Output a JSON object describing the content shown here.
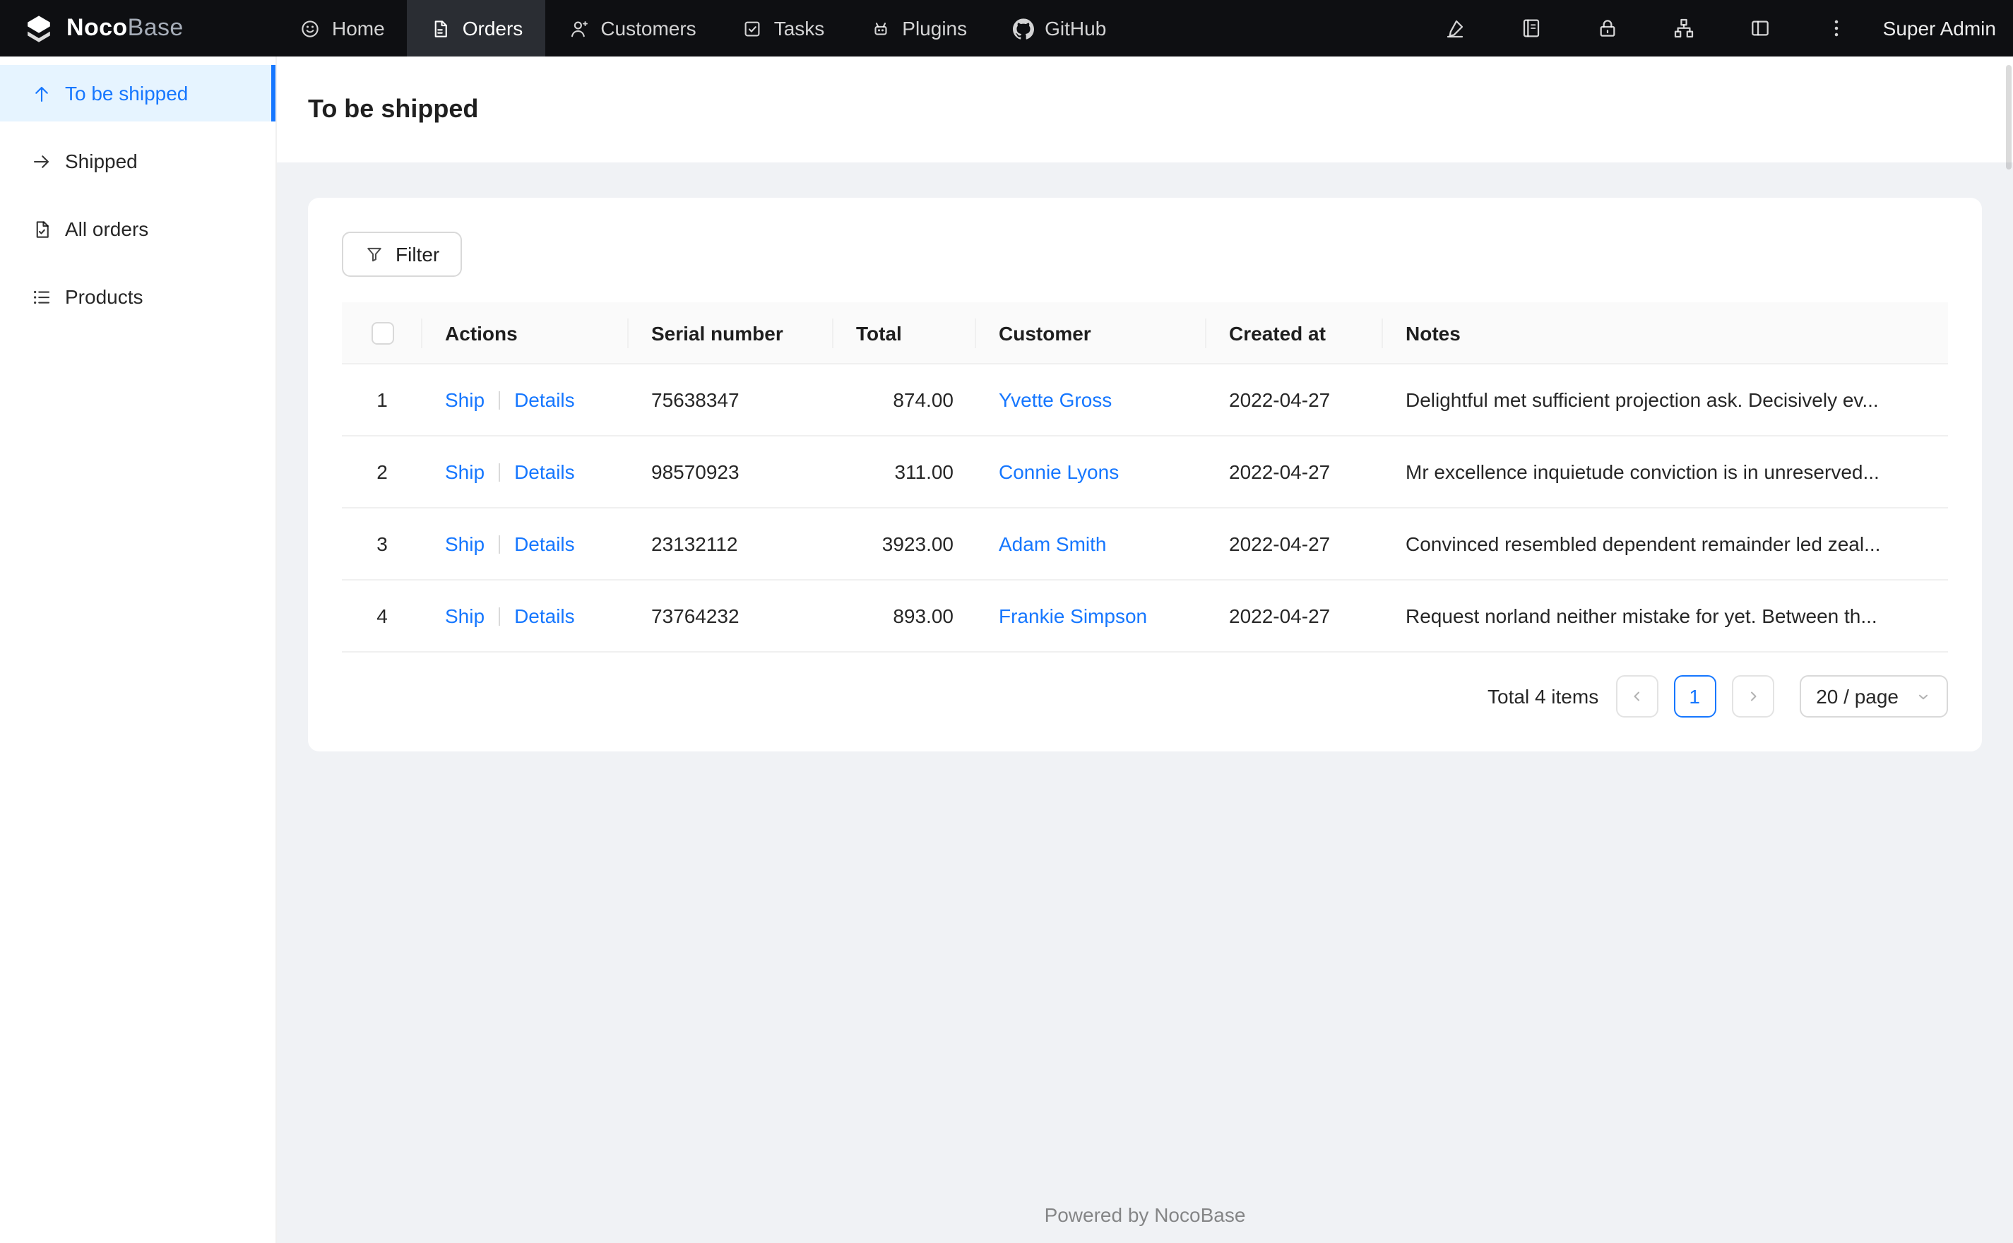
{
  "colors": {
    "accent": "#1677ff",
    "header_bg": "#0e0f12",
    "active_menu_bg": "#e6f4ff"
  },
  "header": {
    "logo_primary": "Noco",
    "logo_secondary": "Base",
    "nav": [
      {
        "label": "Home",
        "icon": "home-icon",
        "active": false
      },
      {
        "label": "Orders",
        "icon": "orders-icon",
        "active": true
      },
      {
        "label": "Customers",
        "icon": "customers-icon",
        "active": false
      },
      {
        "label": "Tasks",
        "icon": "tasks-icon",
        "active": false
      },
      {
        "label": "Plugins",
        "icon": "plugins-icon",
        "active": false
      },
      {
        "label": "GitHub",
        "icon": "github-icon",
        "active": false
      }
    ],
    "tool_icons": [
      {
        "icon": "highlighter-icon"
      },
      {
        "icon": "collections-icon"
      },
      {
        "icon": "lock-icon"
      },
      {
        "icon": "apartment-icon"
      },
      {
        "icon": "layout-icon"
      },
      {
        "icon": "more-icon"
      }
    ],
    "user_name": "Super Admin"
  },
  "sidebar": {
    "items": [
      {
        "label": "To be shipped",
        "icon": "arrow-up-icon",
        "active": true
      },
      {
        "label": "Shipped",
        "icon": "arrow-right-icon",
        "active": false
      },
      {
        "label": "All orders",
        "icon": "order-file-icon",
        "active": false
      },
      {
        "label": "Products",
        "icon": "list-icon",
        "active": false
      }
    ]
  },
  "page": {
    "title": "To be shipped"
  },
  "toolbar": {
    "filter_label": "Filter"
  },
  "table": {
    "columns": [
      "Actions",
      "Serial number",
      "Total",
      "Customer",
      "Created at",
      "Notes"
    ],
    "rows": [
      {
        "index": "1",
        "ship": "Ship",
        "details": "Details",
        "serial": "75638347",
        "total": "874.00",
        "customer": "Yvette Gross",
        "created_at": "2022-04-27",
        "notes": "Delightful met sufficient projection ask. Decisively ev..."
      },
      {
        "index": "2",
        "ship": "Ship",
        "details": "Details",
        "serial": "98570923",
        "total": "311.00",
        "customer": "Connie Lyons",
        "created_at": "2022-04-27",
        "notes": "Mr excellence inquietude conviction is in unreserved..."
      },
      {
        "index": "3",
        "ship": "Ship",
        "details": "Details",
        "serial": "23132112",
        "total": "3923.00",
        "customer": "Adam Smith",
        "created_at": "2022-04-27",
        "notes": "Convinced resembled dependent remainder led zeal..."
      },
      {
        "index": "4",
        "ship": "Ship",
        "details": "Details",
        "serial": "73764232",
        "total": "893.00",
        "customer": "Frankie Simpson",
        "created_at": "2022-04-27",
        "notes": "Request norland neither mistake for yet. Between th..."
      }
    ]
  },
  "pagination": {
    "total_label": "Total 4 items",
    "current_page": "1",
    "page_size": "20 / page"
  },
  "footer": {
    "text": "Powered by NocoBase"
  }
}
